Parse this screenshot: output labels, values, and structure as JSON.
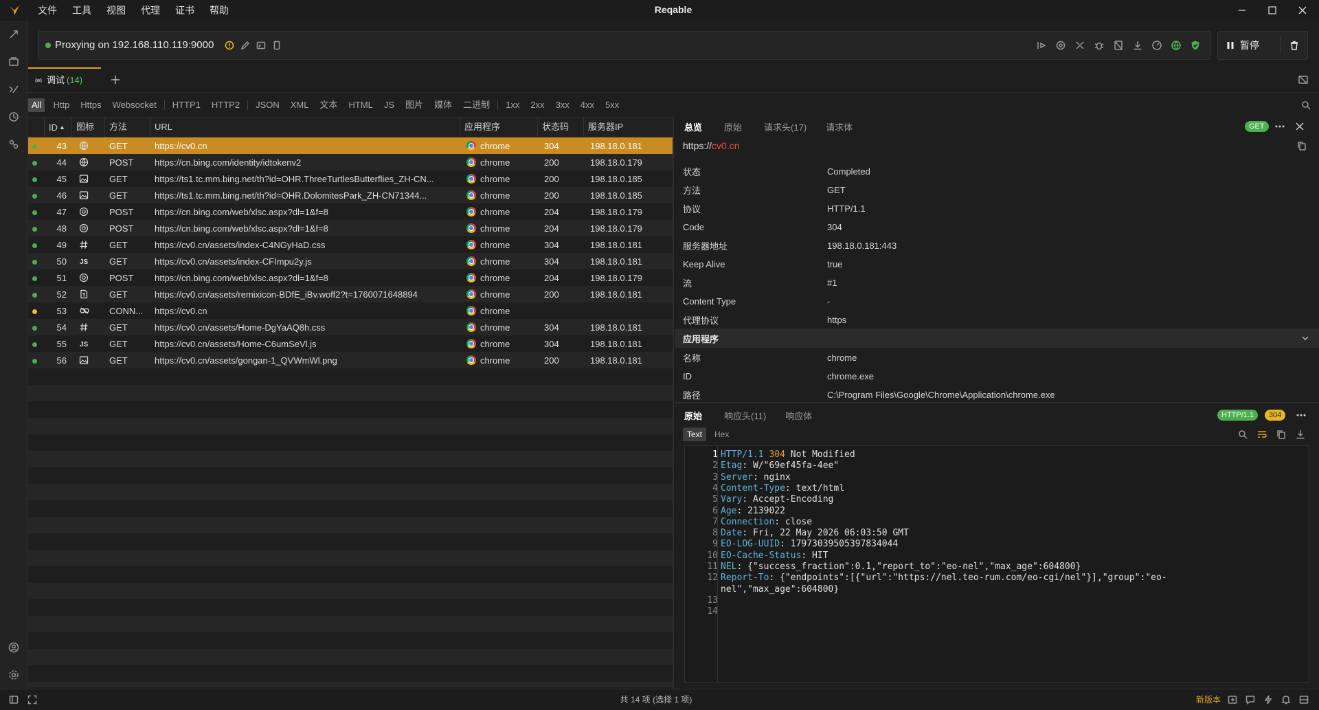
{
  "window": {
    "title": "Reqable",
    "menu": [
      "文件",
      "工具",
      "视图",
      "代理",
      "证书",
      "帮助"
    ]
  },
  "proxy": {
    "status": "Proxying on 192.168.110.119:9000",
    "pause_label": "暂停",
    "status_color": "#4caf50"
  },
  "tabs": {
    "debug_label": "调试",
    "debug_count": "(14)"
  },
  "filters": [
    "All",
    "Http",
    "Https",
    "Websocket",
    "HTTP1",
    "HTTP2",
    "JSON",
    "XML",
    "文本",
    "HTML",
    "JS",
    "图片",
    "媒体",
    "二进制",
    "1xx",
    "2xx",
    "3xx",
    "4xx",
    "5xx"
  ],
  "table": {
    "columns": [
      "ID",
      "图标",
      "方法",
      "URL",
      "应用程序",
      "状态码",
      "服务器IP"
    ],
    "rows": [
      {
        "id": "43",
        "icon": "globe",
        "method": "GET",
        "url": "https://cv0.cn",
        "app": "chrome",
        "status": "304",
        "ip": "198.18.0.181",
        "dot": "green",
        "selected": true
      },
      {
        "id": "44",
        "icon": "globe",
        "method": "POST",
        "url": "https://cn.bing.com/identity/idtokenv2",
        "app": "chrome",
        "status": "200",
        "ip": "198.18.0.179",
        "dot": "green"
      },
      {
        "id": "45",
        "icon": "image",
        "method": "GET",
        "url": "https://ts1.tc.mm.bing.net/th?id=OHR.ThreeTurtlesButterflies_ZH-CN...",
        "app": "chrome",
        "status": "200",
        "ip": "198.18.0.185",
        "dot": "green"
      },
      {
        "id": "46",
        "icon": "image",
        "method": "GET",
        "url": "https://ts1.tc.mm.bing.net/th?id=OHR.DolomitesPark_ZH-CN71344...",
        "app": "chrome",
        "status": "200",
        "ip": "198.18.0.185",
        "dot": "green"
      },
      {
        "id": "47",
        "icon": "target",
        "method": "POST",
        "url": "https://cn.bing.com/web/xlsc.aspx?dl=1&f=8",
        "app": "chrome",
        "status": "204",
        "ip": "198.18.0.179",
        "dot": "green"
      },
      {
        "id": "48",
        "icon": "target",
        "method": "POST",
        "url": "https://cn.bing.com/web/xlsc.aspx?dl=1&f=8",
        "app": "chrome",
        "status": "204",
        "ip": "198.18.0.179",
        "dot": "green"
      },
      {
        "id": "49",
        "icon": "hash",
        "method": "GET",
        "url": "https://cv0.cn/assets/index-C4NGyHaD.css",
        "app": "chrome",
        "status": "304",
        "ip": "198.18.0.181",
        "dot": "green"
      },
      {
        "id": "50",
        "icon": "js",
        "method": "GET",
        "url": "https://cv0.cn/assets/index-CFImpu2y.js",
        "app": "chrome",
        "status": "304",
        "ip": "198.18.0.181",
        "dot": "green"
      },
      {
        "id": "51",
        "icon": "target",
        "method": "POST",
        "url": "https://cn.bing.com/web/xlsc.aspx?dl=1&f=8",
        "app": "chrome",
        "status": "204",
        "ip": "198.18.0.179",
        "dot": "green"
      },
      {
        "id": "52",
        "icon": "font",
        "method": "GET",
        "url": "https://cv0.cn/assets/remixicon-BDfE_iBv.woff2?t=1760071648894",
        "app": "chrome",
        "status": "200",
        "ip": "198.18.0.181",
        "dot": "green"
      },
      {
        "id": "53",
        "icon": "link",
        "method": "CONN...",
        "url": "https://cv0.cn",
        "app": "chrome",
        "status": "",
        "ip": "",
        "dot": "yellow"
      },
      {
        "id": "54",
        "icon": "hash",
        "method": "GET",
        "url": "https://cv0.cn/assets/Home-DgYaAQ8h.css",
        "app": "chrome",
        "status": "304",
        "ip": "198.18.0.181",
        "dot": "green"
      },
      {
        "id": "55",
        "icon": "js",
        "method": "GET",
        "url": "https://cv0.cn/assets/Home-C6umSeVl.js",
        "app": "chrome",
        "status": "304",
        "ip": "198.18.0.181",
        "dot": "green"
      },
      {
        "id": "56",
        "icon": "image",
        "method": "GET",
        "url": "https://cv0.cn/assets/gongan-1_QVWmWl.png",
        "app": "chrome",
        "status": "200",
        "ip": "198.18.0.181",
        "dot": "green"
      }
    ]
  },
  "detail": {
    "tabs": [
      "总览",
      "原始",
      "请求头",
      "请求体"
    ],
    "header_count": "(17)",
    "method_badge": "GET",
    "url_prefix": "https://",
    "url_host": "cv0.cn",
    "overview": [
      {
        "k": "状态",
        "v": "Completed"
      },
      {
        "k": "方法",
        "v": "GET"
      },
      {
        "k": "协议",
        "v": "HTTP/1.1"
      },
      {
        "k": "Code",
        "v": "304"
      },
      {
        "k": "服务器地址",
        "v": "198.18.0.181:443"
      },
      {
        "k": "Keep Alive",
        "v": "true"
      },
      {
        "k": "流",
        "v": "#1"
      },
      {
        "k": "Content Type",
        "v": "-"
      },
      {
        "k": "代理协议",
        "v": "https"
      }
    ],
    "app_section_title": "应用程序",
    "app": [
      {
        "k": "名称",
        "v": "chrome"
      },
      {
        "k": "ID",
        "v": "chrome.exe"
      },
      {
        "k": "路径",
        "v": "C:\\Program Files\\Google\\Chrome\\Application\\chrome.exe"
      }
    ]
  },
  "response": {
    "tabs": [
      "原始",
      "响应头",
      "响应体"
    ],
    "header_count": "(11)",
    "protocol_badge": "HTTP/1.1",
    "status_badge": "304",
    "view_modes": [
      "Text",
      "Hex"
    ],
    "lines": [
      {
        "n": "1",
        "key": "HTTP/1.1",
        "sep": " ",
        "val": "Not Modified",
        "code": "304"
      },
      {
        "n": "2",
        "key": "Etag",
        "sep": ": ",
        "val": "W/\"69ef45fa-4ee\""
      },
      {
        "n": "3",
        "key": "Server",
        "sep": ": ",
        "val": "nginx"
      },
      {
        "n": "4",
        "key": "Content-Type",
        "sep": ": ",
        "val": "text/html"
      },
      {
        "n": "5",
        "key": "Vary",
        "sep": ": ",
        "val": "Accept-Encoding"
      },
      {
        "n": "6",
        "key": "Age",
        "sep": ": ",
        "val": "2139022"
      },
      {
        "n": "7",
        "key": "Connection",
        "sep": ": ",
        "val": "close"
      },
      {
        "n": "8",
        "key": "Date",
        "sep": ": ",
        "val": "Fri, 22 May 2026 06:03:50 GMT"
      },
      {
        "n": "9",
        "key": "EO-LOG-UUID",
        "sep": ": ",
        "val": "17973039505397834044"
      },
      {
        "n": "10",
        "key": "EO-Cache-Status",
        "sep": ": ",
        "val": "HIT"
      },
      {
        "n": "11",
        "key": "NEL",
        "sep": ": ",
        "val": "{\"success_fraction\":0.1,\"report_to\":\"eo-nel\",\"max_age\":604800}"
      },
      {
        "n": "12",
        "key": "Report-To",
        "sep": ": ",
        "val": "{\"endpoints\":[{\"url\":\"https://nel.teo-rum.com/eo-cgi/nel\"}],\"group\":\"eo-",
        "cont": "nel\",\"max_age\":604800}"
      },
      {
        "n": "13",
        "key": "",
        "sep": "",
        "val": ""
      },
      {
        "n": "14",
        "key": "",
        "sep": "",
        "val": ""
      }
    ]
  },
  "statusbar": {
    "summary": "共 14 项 (选择 1 项)",
    "new_version": "新版本"
  },
  "colors": {
    "accent": "#e0a125",
    "selected_row": "#c98b22",
    "green": "#4caf50",
    "yellow": "#f0c020"
  }
}
